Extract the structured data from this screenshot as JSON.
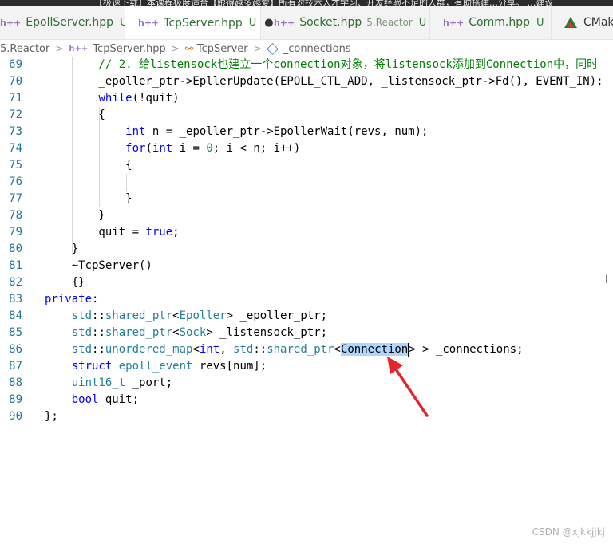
{
  "top_strip": {
    "text": "【极速下载】本课程极度适合【跟得越多越爱】所有对技术人才学习、开发经验不足的人群，有助搭建…分享。 …建议"
  },
  "tabs": [
    {
      "name": "EpollServer.hpp",
      "status": "U",
      "active": false
    },
    {
      "name": "TcpServer.hpp",
      "status": "U",
      "modified_dot": "●",
      "active": true
    },
    {
      "name": "Socket.hpp",
      "sub": "5.Reactor",
      "status": "U",
      "active": false
    },
    {
      "name": "Comm.hpp",
      "status": "U",
      "active": false
    },
    {
      "name": "CMake",
      "active": false
    }
  ],
  "breadcrumb": {
    "folder": "5.Reactor",
    "file": "TcpServer.hpp",
    "class": "TcpServer",
    "member": "_connections",
    "sep": ">"
  },
  "colors": {
    "line_number": "#237893",
    "keyword": "#0000ff",
    "type": "#267f99",
    "comment": "#008000",
    "selection": "#add6ff",
    "arrow": "#e8242b"
  },
  "lines": [
    {
      "n": "69",
      "text": "        // 2. 给listensock也建立一个connection对象，将listensock添加到Connection中，同时"
    },
    {
      "n": "70",
      "text": "        _epoller_ptr->EpllerUpdate(EPOLL_CTL_ADD, _listensock_ptr->Fd(), EVENT_IN);"
    },
    {
      "n": "71",
      "text": "        while(!quit)"
    },
    {
      "n": "72",
      "text": "        {"
    },
    {
      "n": "73",
      "text": "            int n = _epoller_ptr->EpollerWait(revs, num);"
    },
    {
      "n": "74",
      "text": "            for(int i = 0; i < n; i++)"
    },
    {
      "n": "75",
      "text": "            {"
    },
    {
      "n": "76",
      "text": ""
    },
    {
      "n": "77",
      "text": "            }"
    },
    {
      "n": "78",
      "text": "        }"
    },
    {
      "n": "79",
      "text": "        quit = true;"
    },
    {
      "n": "80",
      "text": "    }"
    },
    {
      "n": "81",
      "text": "    ~TcpServer()"
    },
    {
      "n": "82",
      "text": "    {}"
    },
    {
      "n": "83",
      "text": "private:"
    },
    {
      "n": "84",
      "text": "    std::shared_ptr<Epoller> _epoller_ptr;"
    },
    {
      "n": "85",
      "text": "    std::shared_ptr<Sock> _listensock_ptr;"
    },
    {
      "n": "86",
      "text": "    std::unordered_map<int, std::shared_ptr<Connection> > _connections;"
    },
    {
      "n": "87",
      "text": "    struct epoll_event revs[num];"
    },
    {
      "n": "88",
      "text": "    uint16_t _port;"
    },
    {
      "n": "89",
      "text": "    bool quit;"
    },
    {
      "n": "90",
      "text": "};"
    }
  ],
  "selected_word": "Connection",
  "watermark": "CSDN @xjkkjjkj"
}
